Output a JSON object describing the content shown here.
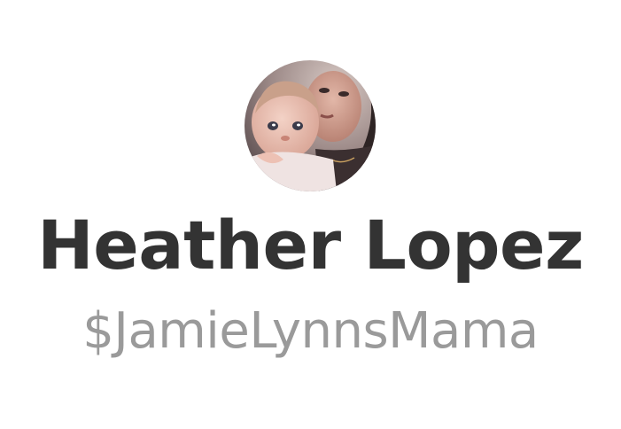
{
  "profile": {
    "avatar_icon": "profile-photo-avatar",
    "display_name": "Heather Lopez",
    "cashtag": "$JamieLynnsMama"
  },
  "colors": {
    "background": "#ffffff",
    "name_text": "#333333",
    "cashtag_text": "#9a9a9a"
  }
}
